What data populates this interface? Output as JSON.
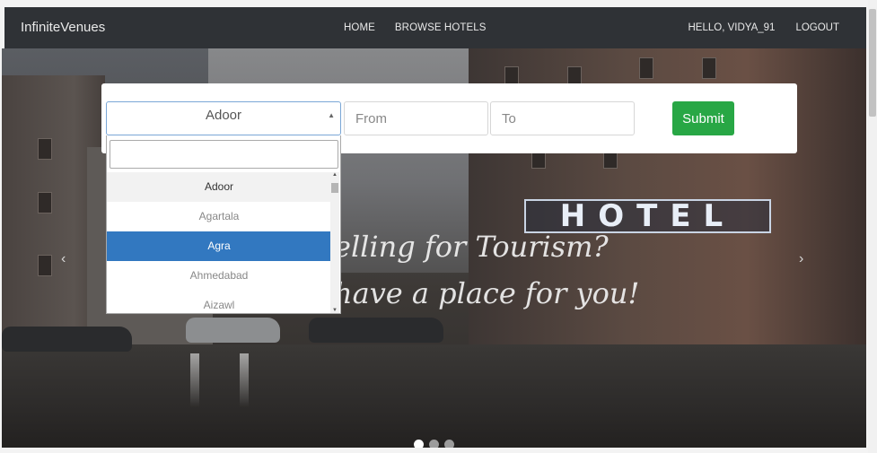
{
  "nav": {
    "brand": "InfiniteVenues",
    "home": "HOME",
    "browse": "BROWSE HOTELS",
    "user": "HELLO, VIDYA_91",
    "logout": "LOGOUT"
  },
  "hero": {
    "sign": "HOTEL",
    "tagline_line1": "elling for Tourism?",
    "tagline_line2": "have a place for you!"
  },
  "search": {
    "city_selected": "Adoor",
    "from_placeholder": "From",
    "to_placeholder": "To",
    "submit_label": "Submit",
    "dropdown_options": [
      "Adoor",
      "Agartala",
      "Agra",
      "Ahmedabad",
      "Aizawl"
    ],
    "highlighted_option": "Agra"
  },
  "carousel": {
    "prev": "‹",
    "next": "›",
    "slides": 3,
    "active_slide": 1
  },
  "icons": {
    "caret": "caret-up-icon",
    "prev": "chevron-left-icon",
    "next": "chevron-right-icon"
  },
  "colors": {
    "navbar": "#2f3236",
    "submit": "#28a745",
    "highlight": "#3278c0"
  }
}
